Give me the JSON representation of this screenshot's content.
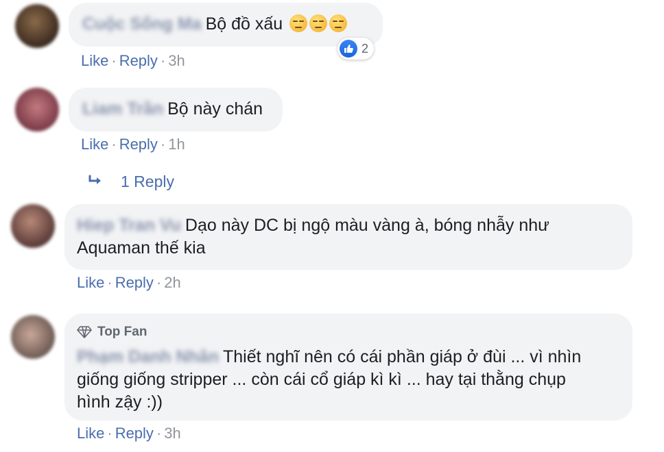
{
  "comments": [
    {
      "author": "Cuộc Sống Ma",
      "text": "Bộ đồ xấu",
      "reaction_count": "2",
      "actions": {
        "like": "Like",
        "reply": "Reply",
        "time": "3h"
      }
    },
    {
      "author": "Liam Trần",
      "text": "Bộ này chán",
      "actions": {
        "like": "Like",
        "reply": "Reply",
        "time": "1h"
      },
      "replies_link": "1 Reply"
    },
    {
      "author": "Hiep Tran Vu",
      "text": "Dạo này DC bị ngộ màu vàng à, bóng nhẫy như Aquaman thế kia",
      "actions": {
        "like": "Like",
        "reply": "Reply",
        "time": "2h"
      }
    },
    {
      "badge": "Top Fan",
      "author": "Phạm Danh Nhân",
      "text": "Thiết nghĩ nên có cái phần giáp ở đùi ... vì nhìn giống giống stripper ... còn cái cổ giáp kì kì ... hay tại thằng chụp hình zậy :))",
      "actions": {
        "like": "Like",
        "reply": "Reply",
        "time": "3h"
      }
    }
  ],
  "colors": {
    "bubble": "#f2f3f5",
    "link": "#4a6dae",
    "meta": "#90949c",
    "like_blue": "#1a63d8"
  }
}
